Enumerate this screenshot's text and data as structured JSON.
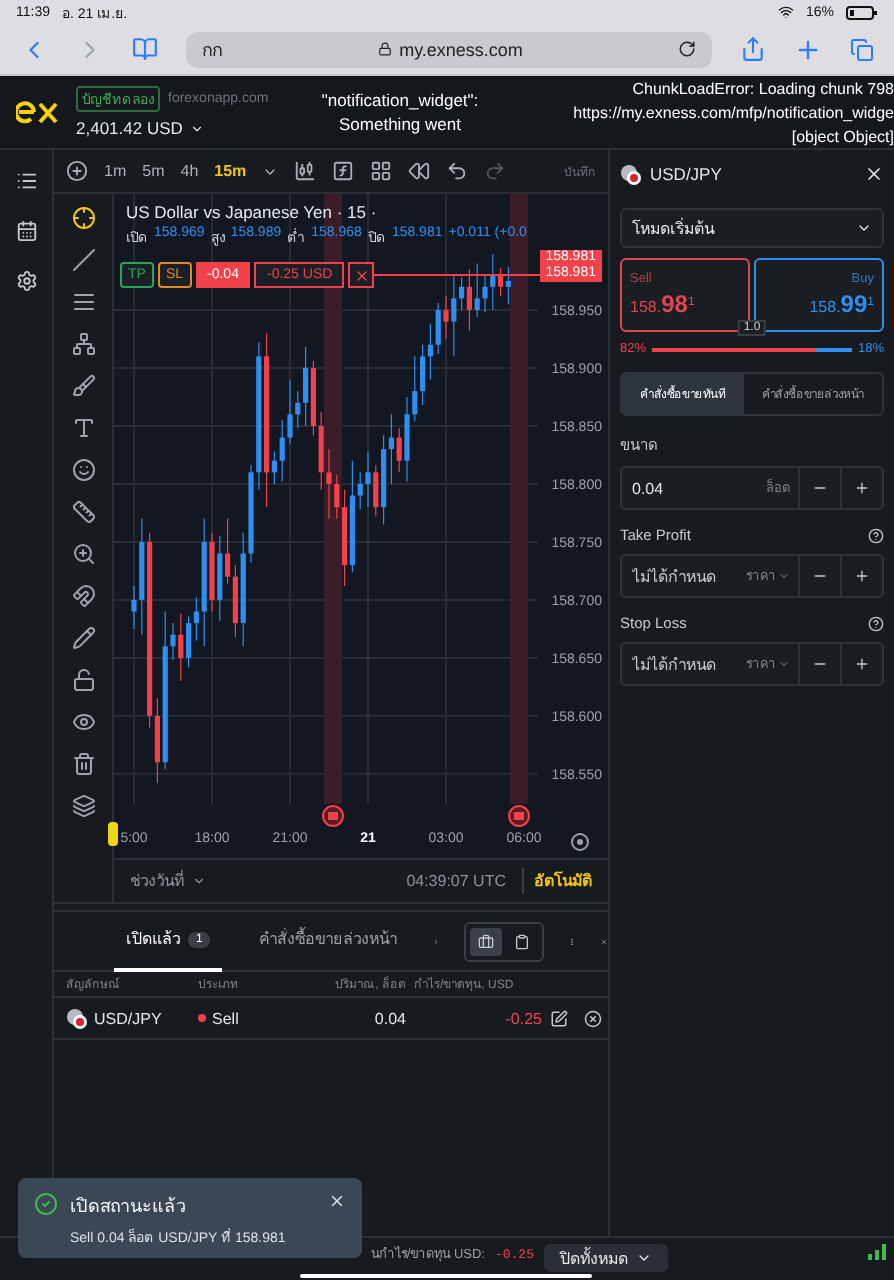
{
  "status_bar": {
    "time": "11:39",
    "date": "อ. 21 เม.ย.",
    "battery": "16%"
  },
  "browser": {
    "text_size": "กก",
    "url": "my.exness.com"
  },
  "header": {
    "account_badge": "บัญชีทดลอง",
    "server": "forexonapp.com",
    "balance": "2,401.42 USD",
    "error_center": [
      "\"notification_widget\":",
      "Something went"
    ],
    "error_right": [
      "ChunkLoadError: Loading chunk 798",
      "https://my.exness.com/mfp/notification_widge",
      "[object Object]"
    ]
  },
  "toolbar": {
    "timeframes": [
      {
        "label": "1m",
        "selected": false
      },
      {
        "label": "5m",
        "selected": false
      },
      {
        "label": "4h",
        "selected": false
      },
      {
        "label": "15m",
        "selected": true
      }
    ],
    "save_label": "บันทึก"
  },
  "chart": {
    "title": "US Dollar vs Japanese Yen · 15 ·",
    "ohlc": [
      {
        "label": "เปิด",
        "value": "158.969"
      },
      {
        "label": "สูง",
        "value": "158.989"
      },
      {
        "label": "ต่ำ",
        "value": "158.968"
      },
      {
        "label": "ปิด",
        "value": "158.981"
      }
    ],
    "change": "+0.011 (+0.0",
    "position": {
      "tp": "TP",
      "sl": "SL",
      "volume": "-0.04",
      "pl": "-0.25 USD"
    },
    "price_tags": [
      "158.981",
      "158.981"
    ],
    "chart_data": {
      "type": "candlestick",
      "ylim": [
        158.524,
        159.05
      ],
      "categories": [
        "5:00",
        null,
        null,
        null,
        null,
        null,
        null,
        null,
        null,
        null,
        "18:00",
        null,
        null,
        null,
        null,
        null,
        null,
        null,
        null,
        null,
        "21:00",
        null,
        null,
        null,
        null,
        null,
        null,
        null,
        null,
        null,
        "21",
        null,
        null,
        null,
        null,
        null,
        null,
        null,
        null,
        null,
        "03:00",
        null,
        null,
        null,
        null,
        null,
        null,
        null,
        null,
        null,
        "06:00"
      ],
      "ohlc": [
        [
          158.69,
          158.712,
          158.675,
          158.7
        ],
        [
          158.7,
          158.77,
          158.67,
          158.75
        ],
        [
          158.75,
          158.758,
          158.59,
          158.6
        ],
        [
          158.6,
          158.615,
          158.542,
          158.56
        ],
        [
          158.56,
          158.69,
          158.554,
          158.66
        ],
        [
          158.66,
          158.68,
          158.648,
          158.67
        ],
        [
          158.67,
          158.688,
          158.63,
          158.65
        ],
        [
          158.65,
          158.686,
          158.642,
          158.68
        ],
        [
          158.68,
          158.702,
          158.665,
          158.69
        ],
        [
          158.69,
          158.77,
          158.66,
          158.75
        ],
        [
          158.75,
          158.758,
          158.69,
          158.7
        ],
        [
          158.7,
          158.755,
          158.682,
          158.74
        ],
        [
          158.74,
          158.77,
          158.714,
          158.72
        ],
        [
          158.72,
          158.73,
          158.668,
          158.68
        ],
        [
          158.68,
          158.758,
          158.66,
          158.74
        ],
        [
          158.74,
          158.816,
          158.732,
          158.81
        ],
        [
          158.81,
          158.922,
          158.795,
          158.91
        ],
        [
          158.91,
          158.93,
          158.78,
          158.81
        ],
        [
          158.81,
          158.828,
          158.8,
          158.82
        ],
        [
          158.82,
          158.855,
          158.802,
          158.84
        ],
        [
          158.84,
          158.89,
          158.834,
          158.86
        ],
        [
          158.86,
          158.88,
          158.848,
          158.87
        ],
        [
          158.87,
          158.918,
          158.85,
          158.9
        ],
        [
          158.9,
          158.906,
          158.842,
          158.85
        ],
        [
          158.85,
          158.862,
          158.795,
          158.81
        ],
        [
          158.81,
          158.83,
          158.77,
          158.8
        ],
        [
          158.8,
          158.808,
          158.77,
          158.78
        ],
        [
          158.78,
          158.795,
          158.712,
          158.73
        ],
        [
          158.73,
          158.82,
          158.724,
          158.79
        ],
        [
          158.79,
          158.81,
          158.778,
          158.8
        ],
        [
          158.8,
          158.828,
          158.78,
          158.81
        ],
        [
          158.81,
          158.816,
          158.772,
          158.78
        ],
        [
          158.78,
          158.842,
          158.765,
          158.83
        ],
        [
          158.83,
          158.86,
          158.8,
          158.84
        ],
        [
          158.84,
          158.848,
          158.81,
          158.82
        ],
        [
          158.82,
          158.875,
          158.802,
          158.86
        ],
        [
          158.86,
          158.91,
          158.854,
          158.88
        ],
        [
          158.88,
          158.92,
          158.868,
          158.91
        ],
        [
          158.91,
          158.938,
          158.89,
          158.92
        ],
        [
          158.92,
          158.956,
          158.912,
          158.95
        ],
        [
          158.95,
          158.962,
          158.925,
          158.94
        ],
        [
          158.94,
          158.98,
          158.91,
          158.96
        ],
        [
          158.96,
          158.978,
          158.95,
          158.97
        ],
        [
          158.97,
          158.985,
          158.932,
          158.95
        ],
        [
          158.95,
          158.99,
          158.944,
          158.96
        ],
        [
          158.96,
          158.98,
          158.948,
          158.97
        ],
        [
          158.97,
          158.998,
          158.95,
          158.98
        ],
        [
          158.98,
          158.986,
          158.962,
          158.97
        ],
        [
          158.97,
          158.987,
          158.955,
          158.975
        ],
        null,
        null
      ],
      "yticks": [
        {
          "value": 158.95,
          "label": "158.950"
        },
        {
          "value": 158.9,
          "label": "158.900"
        },
        {
          "value": 158.85,
          "label": "158.850"
        },
        {
          "value": 158.8,
          "label": "158.800"
        },
        {
          "value": 158.75,
          "label": "158.750"
        },
        {
          "value": 158.7,
          "label": "158.700"
        },
        {
          "value": 158.65,
          "label": "158.650"
        },
        {
          "value": 158.6,
          "label": "158.600"
        },
        {
          "value": 158.55,
          "label": "158.550"
        }
      ],
      "grid": true
    },
    "time_tick_bold": [
      false,
      false,
      false,
      true,
      false,
      false
    ],
    "range_label": "ช่วงวันที่",
    "clock": "04:39:07 UTC",
    "auto_label": "อัตโนมัติ"
  },
  "order_panel": {
    "symbol": "USD/JPY",
    "mode": "โหมดเริ่มต้น",
    "sell": {
      "label": "Sell",
      "price": "158.**98**$^{1}$"
    },
    "buy": {
      "label": "Buy",
      "price": "158.**99**$^{1}$"
    },
    "spread": "1.0",
    "sentiment": {
      "sell_pct": "82%",
      "buy_pct": "18%",
      "level": 0.82
    },
    "order_types": [
      {
        "label": "คำสั่งซื้อขายทันที",
        "selected": true
      },
      {
        "label": "คำสั่งซื้อขายล่วงหน้า",
        "selected": false
      }
    ],
    "size": {
      "label": "ขนาด",
      "value": "0.04",
      "unit": "ล็อต"
    },
    "take_profit": {
      "label": "Take Profit",
      "placeholder": "ไม่ได้กำหนด",
      "unit": "ราคา"
    },
    "stop_loss": {
      "label": "Stop Loss",
      "placeholder": "ไม่ได้กำหนด",
      "unit": "ราคา"
    }
  },
  "positions": {
    "tabs": [
      {
        "label": "เปิดแล้ว",
        "count": "1",
        "selected": true
      },
      {
        "label": "คำสั่งซื้อขายล่วงหน้า",
        "selected": false
      }
    ],
    "view_toggle": [
      {
        "selected": true
      },
      {
        "selected": false
      }
    ],
    "columns": [
      "สัญลักษณ์",
      "ประเภท",
      "ปริมาณ, ล็อต",
      "กำไร/ขาดทุน, USD"
    ],
    "rows": [
      {
        "symbol": "USD/JPY",
        "type": "Sell",
        "volume": "0.04",
        "pl": "-0.25"
      }
    ]
  },
  "footer": {
    "pl_label": "นกำไร/ขาดทุน USD:",
    "pl_value": "-0.25",
    "close_all": "ปิดทั้งหมด"
  },
  "toast": {
    "title": "เปิดสถานะแล้ว",
    "message": "Sell 0.04 ล็อต USD/JPY ที่ 158.981"
  }
}
